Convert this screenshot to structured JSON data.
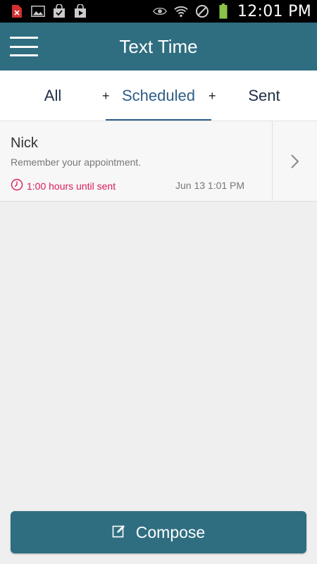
{
  "status_bar": {
    "time": "12:01 PM",
    "left_icons": [
      "file-error-icon",
      "image-icon",
      "bag-check-icon",
      "play-store-icon"
    ],
    "right_icons": [
      "eye-icon",
      "wifi-icon",
      "blocked-icon",
      "battery-icon"
    ]
  },
  "app_bar": {
    "title": "Text Time",
    "menu_icon": "hamburger-menu-icon",
    "color": "#2f6e80"
  },
  "tabs": [
    {
      "label": "All",
      "active": false
    },
    {
      "label": "Scheduled",
      "active": true
    },
    {
      "label": "Sent",
      "active": false
    }
  ],
  "tab_separator": "+",
  "messages": [
    {
      "name": "Nick",
      "message": "Remember your appointment.",
      "countdown": "1:00 hours until sent",
      "date": "Jun 13 1:01 PM",
      "countdown_color": "#d81b5a"
    }
  ],
  "compose": {
    "label": "Compose",
    "icon": "compose-icon"
  }
}
